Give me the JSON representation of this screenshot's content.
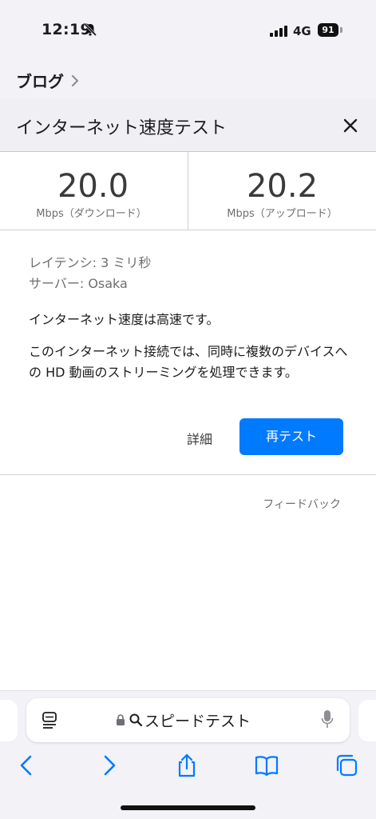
{
  "status_bar": {
    "time": "12:19",
    "network": "4G",
    "battery": "91",
    "icons": [
      "bell-slash-icon",
      "signal-icon",
      "battery-icon"
    ]
  },
  "breadcrumb": {
    "label": "ブログ"
  },
  "header": {
    "title": "インターネット速度テスト",
    "close_icon": "close-icon"
  },
  "speeds": {
    "download": {
      "value": "20.0",
      "unit": "Mbps（ダウンロード）"
    },
    "upload": {
      "value": "20.2",
      "unit": "Mbps（アップロード）"
    }
  },
  "details": {
    "latency": "レイテンシ: 3 ミリ秒",
    "server": "サーバー: Osaka",
    "status": "インターネット速度は高速です。",
    "description": "このインターネット接続では、同時に複数のデバイスへの HD 動画のストリーミングを処理できます。",
    "detail_link": "詳細",
    "retest_button": "再テスト"
  },
  "feedback": "フィードバック",
  "address_bar": {
    "text": "スピードテスト"
  },
  "toolbar": {
    "icons": [
      "back-icon",
      "forward-icon",
      "share-icon",
      "bookmarks-icon",
      "tabs-icon"
    ]
  },
  "colors": {
    "accent": "#007aff",
    "header_bg": "#efeff4",
    "bar_bg": "#f2f2f7"
  }
}
